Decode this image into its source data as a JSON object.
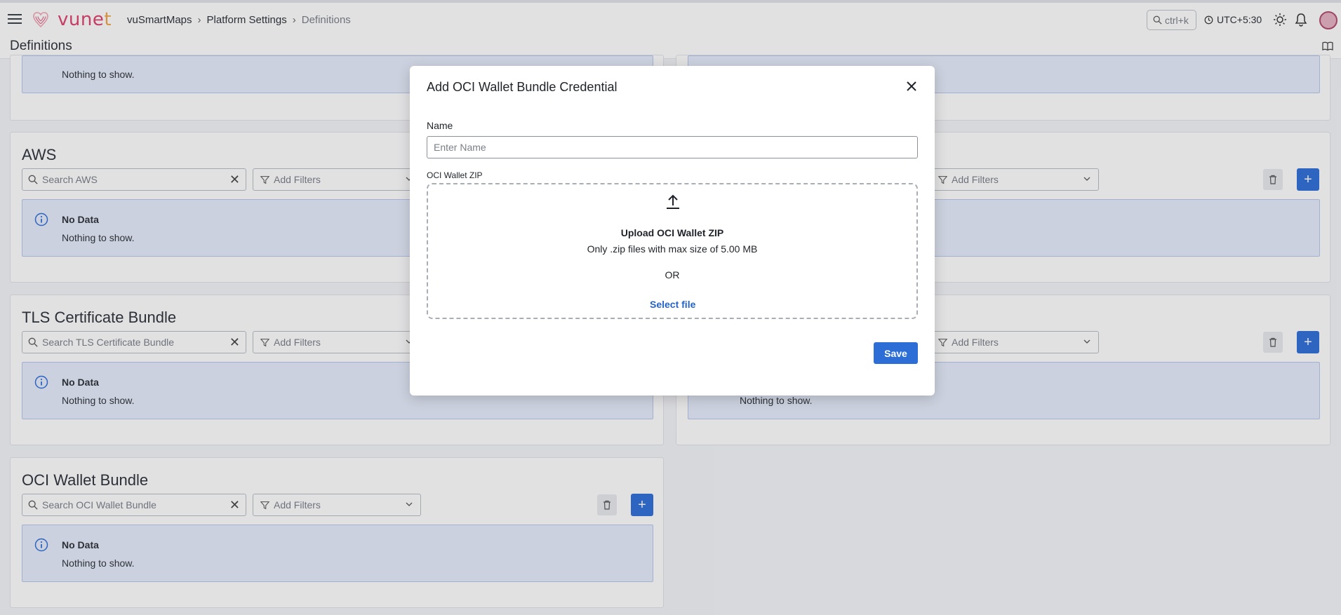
{
  "header": {
    "brand": "vunet",
    "breadcrumb": [
      "vuSmartMaps",
      "Platform Settings",
      "Definitions"
    ],
    "search_shortcut": "ctrl+k",
    "timezone": "UTC+5:30"
  },
  "page": {
    "title": "Definitions"
  },
  "sections": [
    {
      "name": "",
      "search_placeholder": "",
      "filter_placeholder": "",
      "empty_title": "",
      "empty_message": "Nothing to show."
    },
    {
      "name": "AWS",
      "search_placeholder": "Search AWS",
      "filter_placeholder": "Add Filters",
      "empty_title": "No Data",
      "empty_message": "Nothing to show."
    },
    {
      "name": "TLS Certificate Bundle",
      "search_placeholder": "Search TLS Certificate Bundle",
      "filter_placeholder": "Add Filters",
      "empty_title": "No Data",
      "empty_message": "Nothing to show."
    },
    {
      "name": "OCI Wallet Bundle",
      "search_placeholder": "Search OCI Wallet Bundle",
      "filter_placeholder": "Add Filters",
      "empty_title": "No Data",
      "empty_message": "Nothing to show."
    }
  ],
  "right_sections": [
    {
      "filter_placeholder": "Add Filters"
    },
    {
      "filter_placeholder": "Add Filters",
      "empty_message": "Nothing to show."
    }
  ],
  "modal": {
    "title": "Add OCI Wallet Bundle Credential",
    "name_label": "Name",
    "name_placeholder": "Enter Name",
    "name_value": "",
    "zip_label": "OCI Wallet ZIP",
    "upload_title": "Upload OCI Wallet ZIP",
    "upload_hint": "Only .zip files with max size of 5.00 MB",
    "or_text": "OR",
    "select_file": "Select file",
    "save_label": "Save"
  },
  "colors": {
    "primary": "#2c6ed6",
    "info_bg": "#e6edfb",
    "brand_pink": "#e0416e",
    "brand_orange": "#f0a445"
  },
  "icons": [
    "hamburger-icon",
    "vunet-logo-icon",
    "search-icon",
    "clock-icon",
    "sun-icon",
    "bell-icon",
    "book-icon",
    "close-icon",
    "filter-icon",
    "chevron-down-icon",
    "trash-icon",
    "plus-icon",
    "info-icon",
    "upload-icon"
  ]
}
